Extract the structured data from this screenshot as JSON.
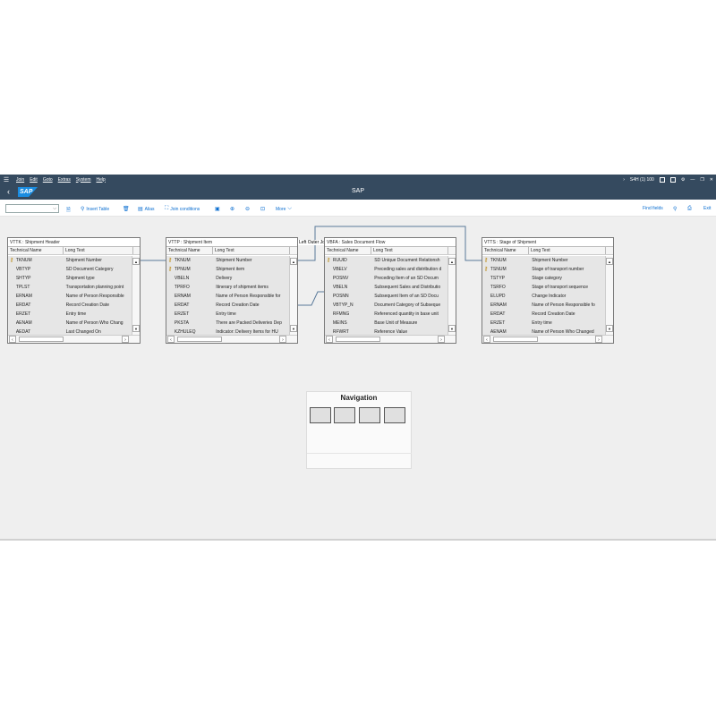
{
  "menu": {
    "items": [
      "Join",
      "Edit",
      "Goto",
      "Extras",
      "System",
      "Help"
    ],
    "system_info": "S4H (1) 100",
    "colors": {
      "shell": "#354a5f",
      "accent": "#0a6ed1"
    }
  },
  "titlebar": {
    "logo": "SAP",
    "title": "SAP"
  },
  "toolbar": {
    "dropdown_value": "",
    "insert_table": "Insert Table",
    "alias": "Alias",
    "join_conditions": "Join conditions",
    "more": "More",
    "find_fields": "Find fields",
    "exit": "Exit"
  },
  "join_label": "Left Outer Join",
  "columns": {
    "technical": "Technical Name",
    "long": "Long Text"
  },
  "tables": [
    {
      "title": "VTTK : Shipment Header",
      "rows": [
        {
          "key": true,
          "tn": "TKNUM",
          "lt": "Shipment Number"
        },
        {
          "key": false,
          "tn": "VBTYP",
          "lt": "SD Document Category"
        },
        {
          "key": false,
          "tn": "SHTYP",
          "lt": "Shipment type"
        },
        {
          "key": false,
          "tn": "TPLST",
          "lt": "Transportation planning point"
        },
        {
          "key": false,
          "tn": "ERNAM",
          "lt": "Name of Person Responsible"
        },
        {
          "key": false,
          "tn": "ERDAT",
          "lt": "Record Creation Date"
        },
        {
          "key": false,
          "tn": "ERZET",
          "lt": "Entry time"
        },
        {
          "key": false,
          "tn": "AENAM",
          "lt": "Name of Person Who Chang"
        },
        {
          "key": false,
          "tn": "AEDAT",
          "lt": "Last Changed On"
        }
      ]
    },
    {
      "title": "VTTP : Shipment Item",
      "rows": [
        {
          "key": true,
          "tn": "TKNUM",
          "lt": "Shipment Number"
        },
        {
          "key": true,
          "tn": "TPNUM",
          "lt": "Shipment item"
        },
        {
          "key": false,
          "tn": "VBELN",
          "lt": "Delivery"
        },
        {
          "key": false,
          "tn": "TPRFO",
          "lt": "Itinerary of shipment items"
        },
        {
          "key": false,
          "tn": "ERNAM",
          "lt": "Name of Person Responsible for"
        },
        {
          "key": false,
          "tn": "ERDAT",
          "lt": "Record Creation Date"
        },
        {
          "key": false,
          "tn": "ERZET",
          "lt": "Entry time"
        },
        {
          "key": false,
          "tn": "PKSTA",
          "lt": "There are Packed Deliveries Dep"
        },
        {
          "key": false,
          "tn": "KZHULEQ",
          "lt": "Indicator: Delivery Items for HU"
        }
      ]
    },
    {
      "title": "VBFA : Sales Document Flow",
      "rows": [
        {
          "key": true,
          "tn": "RUUID",
          "lt": "SD Unique Document Relationsh"
        },
        {
          "key": false,
          "tn": "VBELV",
          "lt": "Preceding sales and distribution d"
        },
        {
          "key": false,
          "tn": "POSNV",
          "lt": "Preceding Item of an SD Docum"
        },
        {
          "key": false,
          "tn": "VBELN",
          "lt": "Subsequent Sales and Distributio"
        },
        {
          "key": false,
          "tn": "POSNN",
          "lt": "Subsequent Item of an SD Docu"
        },
        {
          "key": false,
          "tn": "VBTYP_N",
          "lt": "Document Category of Subseque"
        },
        {
          "key": false,
          "tn": "RFMNG",
          "lt": "Referenced quantity in base unit"
        },
        {
          "key": false,
          "tn": "MEINS",
          "lt": "Base Unit of Measure"
        },
        {
          "key": false,
          "tn": "RFWRT",
          "lt": "Reference Value"
        }
      ]
    },
    {
      "title": "VTTS : Stage of Shipment",
      "rows": [
        {
          "key": true,
          "tn": "TKNUM",
          "lt": "Shipment Number"
        },
        {
          "key": true,
          "tn": "TSNUM",
          "lt": "Stage of transport number"
        },
        {
          "key": false,
          "tn": "TSTYP",
          "lt": "Stage category"
        },
        {
          "key": false,
          "tn": "TSRFO",
          "lt": "Stage of transport sequence"
        },
        {
          "key": false,
          "tn": "ELUPD",
          "lt": "Change Indicator"
        },
        {
          "key": false,
          "tn": "ERNAM",
          "lt": "Name of Person Responsible fo"
        },
        {
          "key": false,
          "tn": "ERDAT",
          "lt": "Record Creation Date"
        },
        {
          "key": false,
          "tn": "ERZET",
          "lt": "Entry time"
        },
        {
          "key": false,
          "tn": "AENAM",
          "lt": "Name of Person Who Changed"
        }
      ]
    }
  ],
  "navigation": {
    "title": "Navigation"
  }
}
